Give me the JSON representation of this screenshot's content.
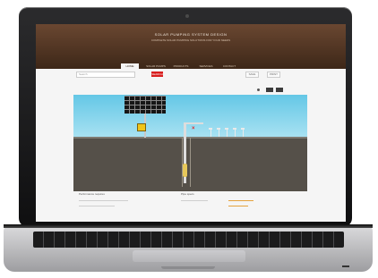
{
  "site": {
    "title": "SOLAR PUMPING SYSTEM DESIGN",
    "subtitle": "COMPLETE SOLAR PUMPING SOLUTIONS FOR YOUR NEEDS"
  },
  "tabs": [
    {
      "label": "HOME"
    },
    {
      "label": "SOLAR PUMPS"
    },
    {
      "label": "PRODUCTS"
    },
    {
      "label": "SERVICES"
    },
    {
      "label": "CONTACT"
    }
  ],
  "toolbar": {
    "search_placeholder": "Search",
    "red_button_label": "SEARCH",
    "small_button_1": "SAVE",
    "small_button_2": "PRINT"
  },
  "lower": {
    "left_heading": "Performance requires",
    "right_heading": "Pipe specs"
  },
  "colors": {
    "header": "#4e3323",
    "sky": "#64c7e6",
    "ground": "#555049",
    "accent": "#d81e1e",
    "controller": "#f0c419"
  }
}
